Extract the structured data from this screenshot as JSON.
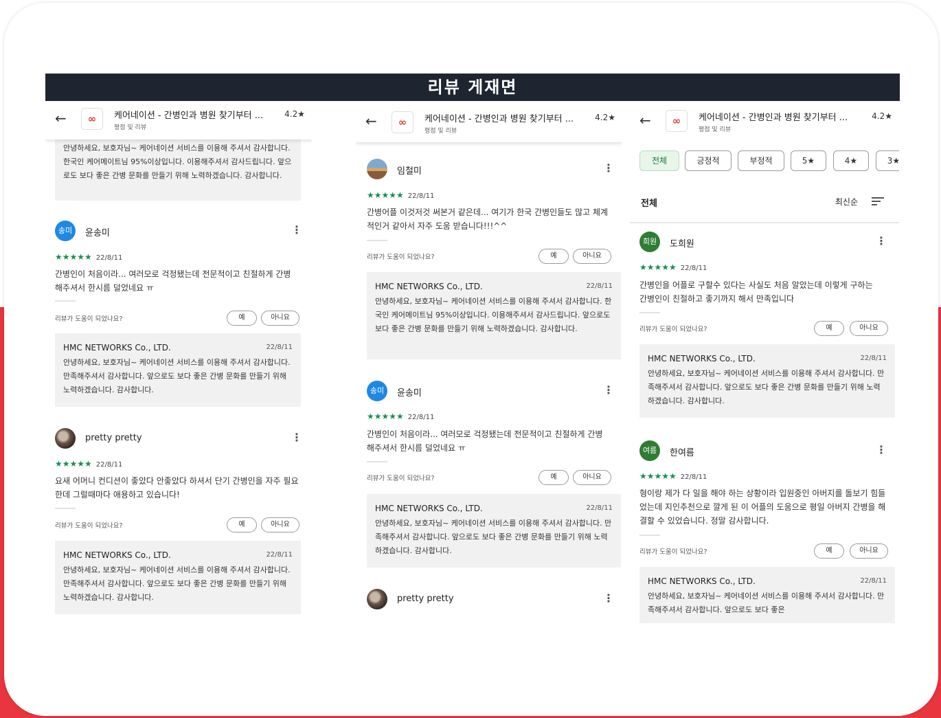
{
  "page_title": "리뷰 게재면",
  "app": {
    "back_icon": "←",
    "logo_icon": "∞",
    "title": "케어네이션 - 간병인과 병원 찾기부터 ...",
    "rating": "4.2★",
    "subtitle": "평점 및 리뷰"
  },
  "common": {
    "stars": "★★★★★",
    "helpful_question": "리뷰가 도움이 되었나요?",
    "yes": "예",
    "no": "아니요",
    "reply_company": "HMC NETWORKS Co., LTD.",
    "more_icon": "⋮"
  },
  "replies": {
    "r1": "안녕하세요, 보호자님~ 케어네이션 서비스를 이용해 주셔서 감사합니다. 한국인 케어메이트님 95%이상입니다. 이용해주셔서 감사드립니다. 앞으로도 보다 좋은 간병 문화를 만들기 위해 노력하겠습니다. 감사합니다.",
    "r2": "안녕하세요, 보호자님~ 케어네이션 서비스를 이용해 주셔서 감사합니다. 만족해주셔서 감사합니다. 앞으로도 보다 좋은 간병 문화를 만들기 위해 노력하겠습니다. 감사합니다.",
    "r3_partial": "안녕하세요, 보호자님~ 케어네이션 서비스를 이용해 주셔서 감사합니다. 만족해주셔서 감사합니다. 앞으로도 보다 좋은"
  },
  "reviews": {
    "songmi": {
      "avatar": "송미",
      "name": "윤송미",
      "date": "22/8/11",
      "body": "간병인이 처음이라... 여러모로 걱정됐는데 전문적이고 친절하게 간병 해주셔서 한시름 덜었네요 ㅠ",
      "reply_date": "22/8/11"
    },
    "pretty": {
      "name": "pretty pretty",
      "date": "22/8/11",
      "body": "요새 어머니 컨디션이 좋았다 안좋았다 하셔서 단기 간병인을 자주 필요한데 그럴때마다 애용하고 있습니다!",
      "reply_date": "22/8/11"
    },
    "imcheolmi": {
      "name": "임철미",
      "date": "22/8/11",
      "body": "간병어플 이것저것 써본거 같은데... 여기가 한국 간병인들도 많고 체계적인거 같아서 자주 도움 받습니다!!!^^",
      "reply_date": "22/8/11"
    },
    "dohuiwon": {
      "avatar": "희원",
      "name": "도희원",
      "date": "22/8/11",
      "body": "간병인을 어플로 구할수 있다는 사실도 처음 알았는데 이렇게 구하는 간병인이 친절하고 좋기까지 해서 만족입니다",
      "reply_date": "22/8/11"
    },
    "hanyeoreum": {
      "avatar": "여름",
      "name": "한여름",
      "date": "22/8/11",
      "body": "형이랑 제가 다 일을 해야 하는 상황이라 입원중인 아버지를 돌보기 힘들었는데 지인추천으로 깔게 된 이 어플의 도움으로 평일 아버지 간병을 해결할 수 있었습니다. 정말 감사합니다.",
      "reply_date": "22/8/11"
    }
  },
  "filters": {
    "chips": [
      "전체",
      "긍정적",
      "부정적",
      "5★",
      "4★",
      "3★"
    ],
    "active": "전체",
    "label": "전체",
    "sort": "최신순"
  },
  "colors": {
    "title_bar": "#1f2530",
    "star_green": "#1a8d50",
    "accent_red": "#e8353e",
    "avatar_blue": "#1e88e5",
    "avatar_green": "#2e7d32"
  }
}
